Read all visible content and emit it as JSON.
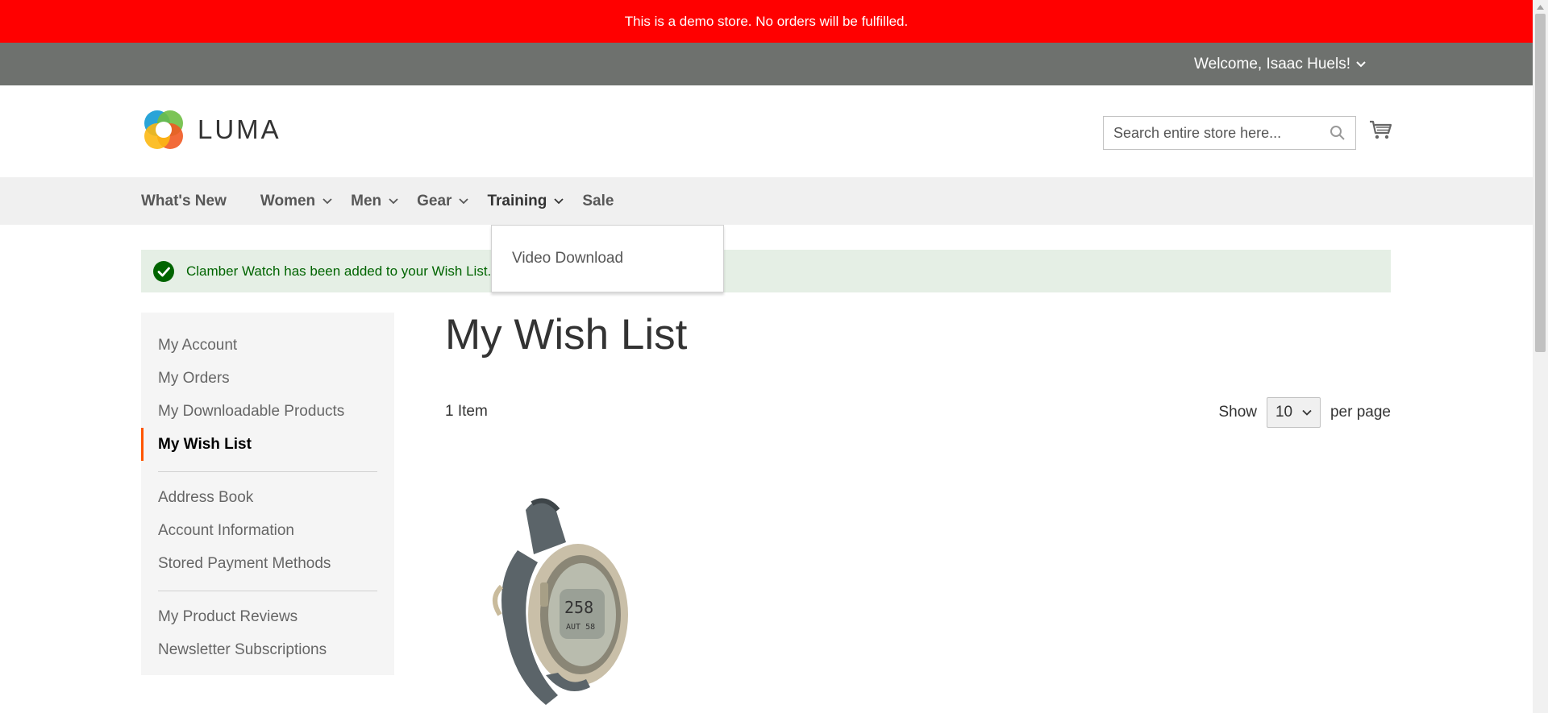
{
  "demo_notice": "This is a demo store. No orders will be fulfilled.",
  "header": {
    "welcome": "Welcome, Isaac Huels!",
    "logo_text": "LUMA",
    "search_placeholder": "Search entire store here..."
  },
  "nav": {
    "items": [
      "What's New",
      "Women",
      "Men",
      "Gear",
      "Training",
      "Sale"
    ],
    "dropdown": {
      "open_under": "Training",
      "items": [
        "Video Download"
      ]
    }
  },
  "message": {
    "text": "Clamber Watch has been added to your Wish List.",
    "color": "#006400"
  },
  "sidebar": {
    "group1": [
      "My Account",
      "My Orders",
      "My Downloadable Products",
      "My Wish List"
    ],
    "group2": [
      "Address Book",
      "Account Information",
      "Stored Payment Methods"
    ],
    "group3": [
      "My Product Reviews",
      "Newsletter Subscriptions"
    ],
    "current": "My Wish List",
    "current_accent": "#ff5501"
  },
  "main": {
    "title": "My Wish List",
    "item_count": "1 Item",
    "show_label": "Show",
    "per_page_value": "10",
    "per_page_label": "per page"
  },
  "colors": {
    "demo_bar": "#ff0000",
    "panel_header": "#6e716e",
    "nav_bg": "#f0f0f0",
    "message_bg": "#e5efe5"
  }
}
